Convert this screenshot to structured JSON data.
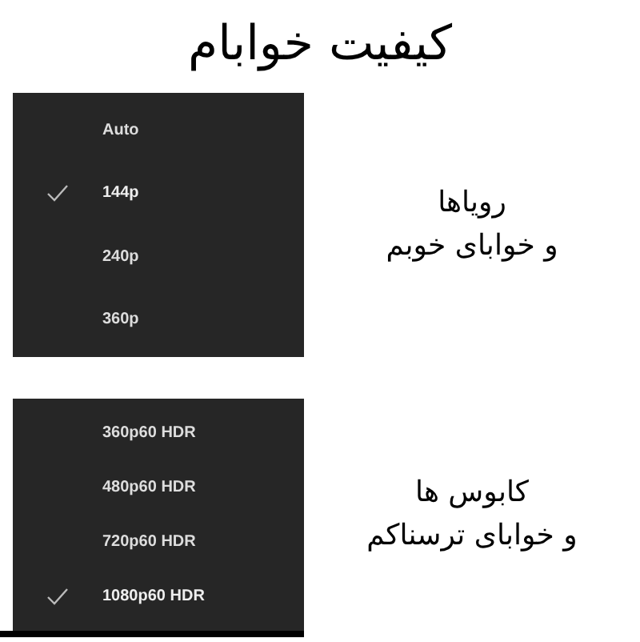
{
  "title": "کیفیت خوابام",
  "panels": [
    {
      "options": [
        {
          "label": "Auto",
          "selected": false
        },
        {
          "label": "144p",
          "selected": true
        },
        {
          "label": "240p",
          "selected": false
        },
        {
          "label": "360p",
          "selected": false
        }
      ],
      "caption": "رویاها\nو خوابای خوبم"
    },
    {
      "options": [
        {
          "label": "360p60 HDR",
          "selected": false
        },
        {
          "label": "480p60 HDR",
          "selected": false
        },
        {
          "label": "720p60 HDR",
          "selected": false
        },
        {
          "label": "1080p60 HDR",
          "selected": true
        }
      ],
      "caption": "کابوس ها\nو خوابای ترسناکم"
    }
  ]
}
